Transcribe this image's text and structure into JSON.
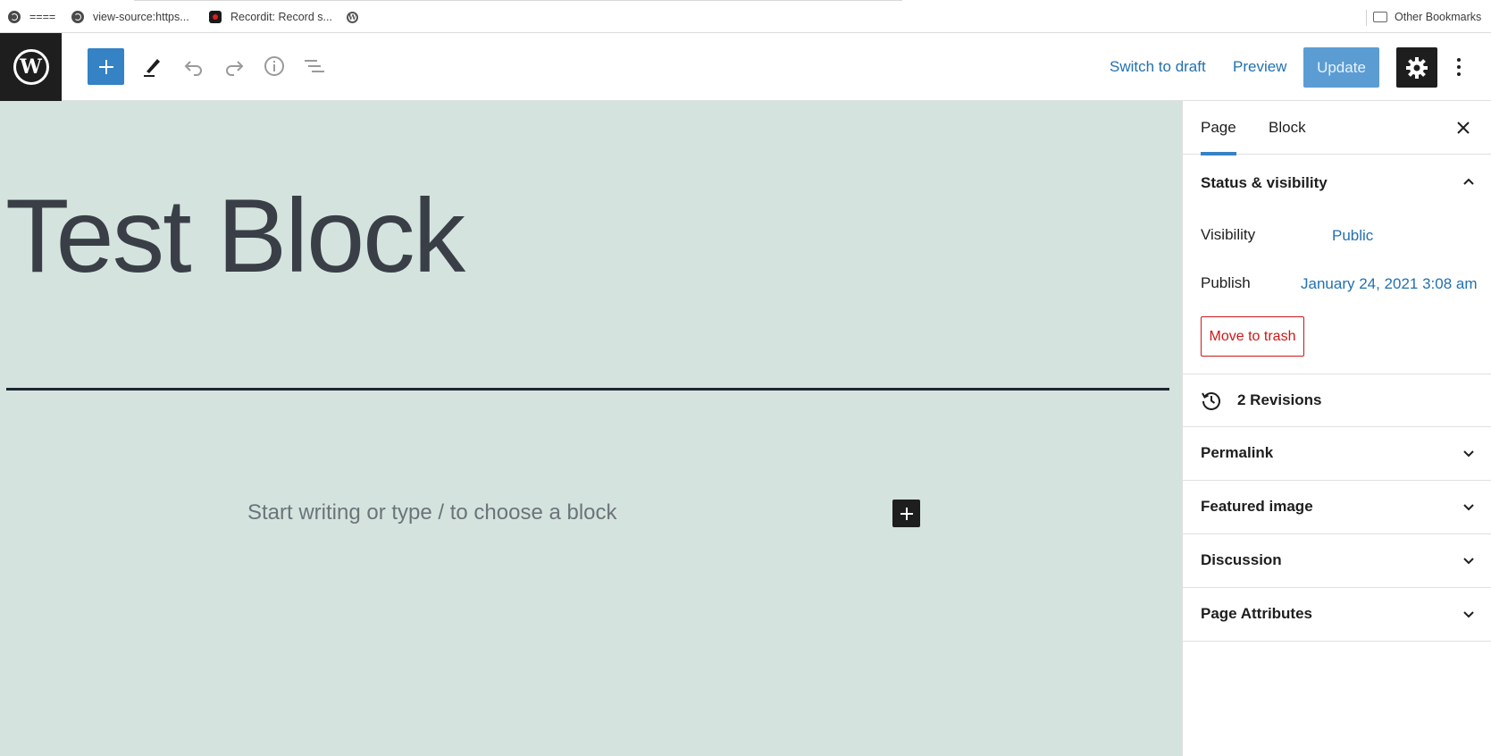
{
  "bookmarks": {
    "items": [
      {
        "label": "====",
        "icon": "globe-icon"
      },
      {
        "label": "view-source:https...",
        "icon": "globe-icon"
      },
      {
        "label": "Recordit: Record s...",
        "icon": "recordit-icon"
      },
      {
        "label": "",
        "icon": "wordpress-icon"
      }
    ],
    "other_label": "Other Bookmarks"
  },
  "header": {
    "logo_icon": "wordpress-logo-icon",
    "tools": [
      "add-block-icon",
      "edit-tools-icon",
      "undo-icon",
      "redo-icon",
      "info-icon",
      "list-view-icon"
    ],
    "switch_to_draft": "Switch to draft",
    "preview": "Preview",
    "update": "Update",
    "settings_icon": "gear-icon",
    "more_icon": "more-vertical-icon"
  },
  "editor": {
    "title": "Test Block",
    "placeholder": "Start writing or type / to choose a block",
    "canvas_color": "#d4e3de"
  },
  "sidebar": {
    "tabs": [
      {
        "label": "Page",
        "active": true
      },
      {
        "label": "Block",
        "active": false
      }
    ],
    "status": {
      "title": "Status & visibility",
      "visibility_label": "Visibility",
      "visibility_value": "Public",
      "publish_label": "Publish",
      "publish_value": "January 24, 2021 3:08 am",
      "trash": "Move to trash"
    },
    "revisions": "2 Revisions",
    "panels": [
      "Permalink",
      "Featured image",
      "Discussion",
      "Page Attributes"
    ]
  },
  "colors": {
    "accent": "#3582c4",
    "link": "#2271b1",
    "danger": "#cc1818",
    "dark": "#1e1e1e"
  }
}
